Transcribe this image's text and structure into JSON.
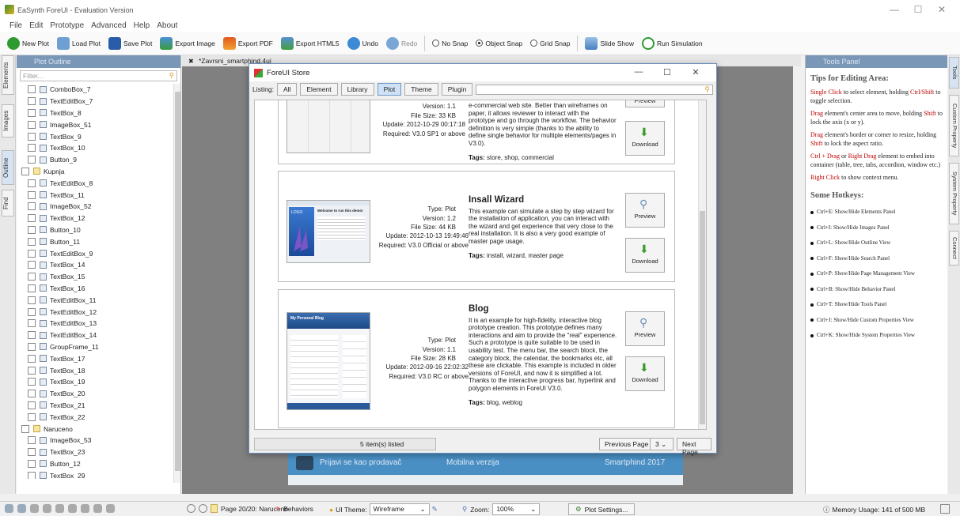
{
  "window": {
    "title": "EaSynth ForeUI - Evaluation Version"
  },
  "menu": [
    "File",
    "Edit",
    "Prototype",
    "Advanced",
    "Help",
    "About"
  ],
  "toolbar": {
    "new_plot": "New Plot",
    "load_plot": "Load Plot",
    "save_plot": "Save Plot",
    "export_image": "Export Image",
    "export_pdf": "Export PDF",
    "export_html5": "Export HTML5",
    "undo": "Undo",
    "redo": "Redo",
    "no_snap": "No Snap",
    "object_snap": "Object Snap",
    "grid_snap": "Grid Snap",
    "slide_show": "Slide Show",
    "run_simulation": "Run Simulation"
  },
  "left_tabs": [
    "Elements",
    "Images",
    "Outline",
    "Find"
  ],
  "outline": {
    "title": "Plot Outline",
    "filter_placeholder": "Filter...",
    "items": [
      {
        "label": "ComboBox_7",
        "level": 1
      },
      {
        "label": "TextEditBox_7",
        "level": 1
      },
      {
        "label": "TextBox_8",
        "level": 1
      },
      {
        "label": "ImageBox_51",
        "level": 1
      },
      {
        "label": "TextBox_9",
        "level": 1
      },
      {
        "label": "TextBox_10",
        "level": 1
      },
      {
        "label": "Button_9",
        "level": 1
      },
      {
        "label": "Kupnja",
        "level": 0
      },
      {
        "label": "TextEditBox_8",
        "level": 1
      },
      {
        "label": "TextBox_11",
        "level": 1
      },
      {
        "label": "ImageBox_52",
        "level": 1
      },
      {
        "label": "TextBox_12",
        "level": 1
      },
      {
        "label": "Button_10",
        "level": 1
      },
      {
        "label": "Button_11",
        "level": 1
      },
      {
        "label": "TextEditBox_9",
        "level": 1
      },
      {
        "label": "TextBox_14",
        "level": 1
      },
      {
        "label": "TextBox_15",
        "level": 1
      },
      {
        "label": "TextBox_16",
        "level": 1
      },
      {
        "label": "TextEditBox_11",
        "level": 1
      },
      {
        "label": "TextEditBox_12",
        "level": 1
      },
      {
        "label": "TextEditBox_13",
        "level": 1
      },
      {
        "label": "TextEditBox_14",
        "level": 1
      },
      {
        "label": "GroupFrame_11",
        "level": 1
      },
      {
        "label": "TextBox_17",
        "level": 1
      },
      {
        "label": "TextBox_18",
        "level": 1
      },
      {
        "label": "TextBox_19",
        "level": 1
      },
      {
        "label": "TextBox_20",
        "level": 1
      },
      {
        "label": "TextBox_21",
        "level": 1
      },
      {
        "label": "TextBox_22",
        "level": 1
      },
      {
        "label": "Naruceno",
        "level": 0
      },
      {
        "label": "ImageBox_53",
        "level": 1
      },
      {
        "label": "TextBox_23",
        "level": 1
      },
      {
        "label": "Button_12",
        "level": 1
      },
      {
        "label": "TextBox_29",
        "level": 1
      }
    ]
  },
  "doc_tab": "*Zavrsni_smartphind.4ui",
  "canvas_footer": {
    "left": "Prijavi se kao prodavač",
    "middle": "Mobilna verzija",
    "right": "Smartphind 2017"
  },
  "store": {
    "title": "ForeUI Store",
    "listing_label": "Listing:",
    "filters": [
      "All",
      "Element",
      "Library",
      "Plot",
      "Theme",
      "Plugin"
    ],
    "selected_filter": "Plot",
    "items": [
      {
        "name": "",
        "type": "",
        "version": "Version: 1.1",
        "size": "File Size: 33 KB",
        "update": "Update: 2012-10-29 00:17:18",
        "required": "Required: V3.0 SP1 or above",
        "desc": "e-commercial web site. Better than wireframes on paper, it allows reviewer to interact with the prototype and go through the workflow. The behavior definition is very simple (thanks to the ability to define single behavior for multiple elements/pages in V3.0).",
        "tags": "store, shop, commercial"
      },
      {
        "name": "Insall Wizard",
        "type": "Type: Plot",
        "version": "Version: 1.2",
        "size": "File Size: 44 KB",
        "update": "Update: 2012-10-13 19:49:46",
        "required": "Required: V3.0 Official or above",
        "desc": "This example can simulate a step by step wizard for the installation of application, you can interact with the wizard and get experience that very close to the real installation. It is also a very good example of master page usage.",
        "tags": "install, wizard, master page"
      },
      {
        "name": "Blog",
        "type": "Type: Plot",
        "version": "Version: 1.1",
        "size": "File Size: 28 KB",
        "update": "Update: 2012-09-16 22:02:32",
        "required": "Required: V3.0 RC or above",
        "desc": "It is an example for high-fidelity, interactive blog prototype creation. This prototype defines many interactions and aim to provide the \"real\" experience. Such a prototype is quite suitable to be used in usability test. The menu bar, the search block, the category block, the calendar, the bookmarks etc, all these are clickable. This example is included in older versions of ForeUI, and now it is simplified a lot. Thanks to the interactive progress bar, hyperlink and polygon elements in ForeUI V3.0.",
        "tags": "blog, weblog"
      }
    ],
    "tags_label": "Tags:",
    "preview_label": "Preview",
    "download_label": "Download",
    "wizard_thumb_logo": "LOGO",
    "wizard_thumb_text": "Welcome to run this demo!",
    "blog_thumb_title": "My Personal Blog",
    "count": "5 item(s) listed",
    "prev": "Previous Page",
    "page": "3",
    "next": "Next Page"
  },
  "tools_panel": {
    "title": "Tools Panel",
    "tips_title": "Tips for Editing Area:",
    "tips": [
      {
        "red": "Single Click",
        "text": " to select element, holding "
      },
      {
        "red": "Drag",
        "text": " element's center area to move, holding "
      },
      {
        "red": "Drag",
        "text": " element's border or corner to resize, holding "
      },
      {
        "red": "Ctrl + Drag",
        "text": " or "
      },
      {
        "red": "Right Click",
        "text": " to show context menu."
      }
    ],
    "tip_lines": {
      "t1a": "Single Click",
      "t1b": " to select element, holding ",
      "t1c": "Ctrl/Shift",
      "t1d": " to toggle selection.",
      "t2a": "Drag",
      "t2b": " element's center area to move, holding ",
      "t2c": "Shift",
      "t2d": " to lock the axis (x or y).",
      "t3a": "Drag",
      "t3b": " element's border or corner to resize, holding ",
      "t3c": "Shift",
      "t3d": " to lock the aspect ratio.",
      "t4a": "Ctrl + Drag",
      "t4b": " or ",
      "t4c": "Right Drag",
      "t4d": " element to embed into container (table, tree, tabs, accordion, window etc.)",
      "t5a": "Right Click",
      "t5b": " to show context menu."
    },
    "hotkeys_title": "Some Hotkeys:",
    "hotkeys": [
      "Ctrl+E: Show/Hide Elements Panel",
      "Ctrl+I: Show/Hide Images Panel",
      "Ctrl+L: Show/Hide Outline View",
      "Ctrl+F: Show/Hide Search Panel",
      "Ctrl+P: Show/Hide Page Management View",
      "Ctrl+B: Show/Hide Behavior Panel",
      "Ctrl+T: Show/Hide Tools Panel",
      "Ctrl+J: Show/Hide Custom Properties View",
      "Ctrl+K: Show/Hide System Properties View"
    ]
  },
  "right_tabs": [
    "Tools",
    "Custom Property",
    "System Property",
    "Connect"
  ],
  "status": {
    "page": "Page 20/20: Naruceno",
    "behaviors": "Behaviors",
    "ui_theme_label": "UI Theme:",
    "ui_theme_value": "Wireframe",
    "zoom_label": "Zoom:",
    "zoom_value": "100%",
    "plot_settings": "Plot Settings...",
    "memory": "Memory Usage: 141 of 500 MB"
  }
}
